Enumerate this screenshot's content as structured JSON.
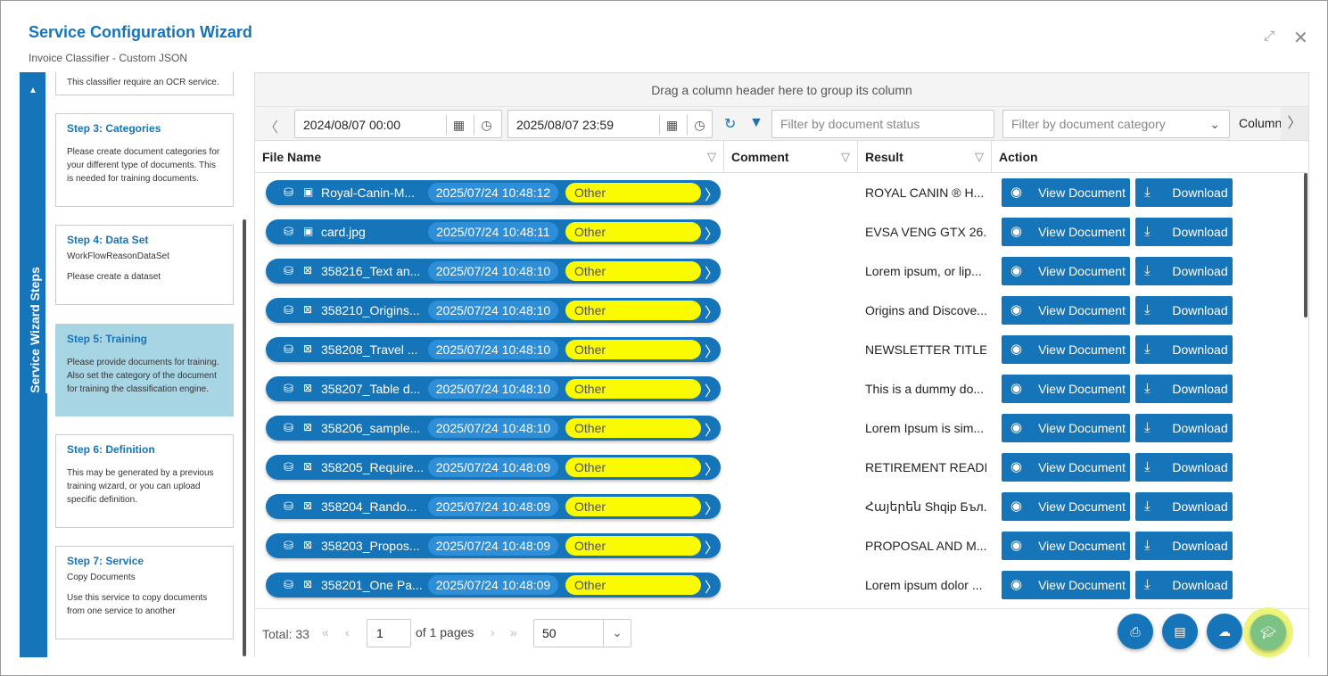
{
  "dialog": {
    "title": "Service Configuration Wizard",
    "subtitle": "Invoice Classifier - Custom JSON",
    "expand_icon": "expand-icon",
    "close_icon": "close-icon"
  },
  "sidebar": {
    "label": "Service Wizard Steps",
    "pin_icon": "pin-icon",
    "partial_step_text": "This classifier require an OCR service.",
    "steps": [
      {
        "title": "Step 3: Categories",
        "subtitle": "",
        "description": "Please create document categories for your different type of documents. This is needed for training documents."
      },
      {
        "title": "Step 4: Data Set",
        "subtitle": "WorkFlowReasonDataSet",
        "description": "Please create a dataset"
      },
      {
        "title": "Step 5: Training",
        "subtitle": "",
        "description": "Please provide documents for training. Also set the category of the document for training the classification engine.",
        "active": true
      },
      {
        "title": "Step 6: Definition",
        "subtitle": "",
        "description": "This may be generated by a previous training wizard, or you can upload specific definition."
      },
      {
        "title": "Step 7: Service",
        "subtitle": "Copy Documents",
        "description": "Use this service to copy documents from one service to another"
      }
    ]
  },
  "grid": {
    "group_hint": "Drag a column header here to group its column",
    "toolbar": {
      "date_from": "2024/08/07 00:00",
      "date_to": "2025/08/07 23:59",
      "status_filter_placeholder": "Filter by document status",
      "category_filter_placeholder": "Filter by document category",
      "columns_label": "Column"
    },
    "columns": [
      "File Name",
      "Comment",
      "Result",
      "Action"
    ],
    "rows": [
      {
        "file": "Royal-Canin-M...",
        "file_icon": "image-icon",
        "date": "2025/07/24 10:48:12",
        "category": "Other",
        "comment": "",
        "result": "ROYAL CANIN ® H..."
      },
      {
        "file": "card.jpg",
        "file_icon": "image-icon",
        "date": "2025/07/24 10:48:11",
        "category": "Other",
        "comment": "",
        "result": "EVSA VENG GTX 26..."
      },
      {
        "file": "358216_Text an...",
        "file_icon": "pdf-icon",
        "date": "2025/07/24 10:48:10",
        "category": "Other",
        "comment": "",
        "result": "Lorem ipsum, or lip..."
      },
      {
        "file": "358210_Origins...",
        "file_icon": "pdf-icon",
        "date": "2025/07/24 10:48:10",
        "category": "Other",
        "comment": "",
        "result": "Origins and Discove..."
      },
      {
        "file": "358208_Travel ...",
        "file_icon": "pdf-icon",
        "date": "2025/07/24 10:48:10",
        "category": "Other",
        "comment": "",
        "result": "NEWSLETTER TITLE ..."
      },
      {
        "file": "358207_Table d...",
        "file_icon": "pdf-icon",
        "date": "2025/07/24 10:48:10",
        "category": "Other",
        "comment": "",
        "result": "This is a dummy do..."
      },
      {
        "file": "358206_sample...",
        "file_icon": "pdf-icon",
        "date": "2025/07/24 10:48:10",
        "category": "Other",
        "comment": "",
        "result": "Lorem Ipsum is sim..."
      },
      {
        "file": "358205_Require...",
        "file_icon": "pdf-icon",
        "date": "2025/07/24 10:48:09",
        "category": "Other",
        "comment": "",
        "result": "RETIREMENT READI..."
      },
      {
        "file": "358204_Rando...",
        "file_icon": "pdf-icon",
        "date": "2025/07/24 10:48:09",
        "category": "Other",
        "comment": "",
        "result": "Հայերեն Shqip Бъл..."
      },
      {
        "file": "358203_Propos...",
        "file_icon": "pdf-icon",
        "date": "2025/07/24 10:48:09",
        "category": "Other",
        "comment": "",
        "result": "PROPOSAL AND M..."
      },
      {
        "file": "358201_One Pa...",
        "file_icon": "pdf-icon",
        "date": "2025/07/24 10:48:09",
        "category": "Other",
        "comment": "",
        "result": "Lorem ipsum dolor ..."
      }
    ],
    "view_label": "View Document",
    "download_label": "Download",
    "footer": {
      "total": "Total: 33",
      "page": "1",
      "of_pages": "of 1 pages",
      "page_size": "50"
    },
    "fab_icons": [
      "pdf-icon",
      "spreadsheet-icon",
      "cloud-upload-icon",
      "graduation-cap-icon"
    ]
  },
  "colors": {
    "accent": "#1674b8",
    "date_pill": "#2e8fd8",
    "category_pill": "#fafa00",
    "active_step": "#a8d5e4",
    "train_button": "#7cc284"
  }
}
